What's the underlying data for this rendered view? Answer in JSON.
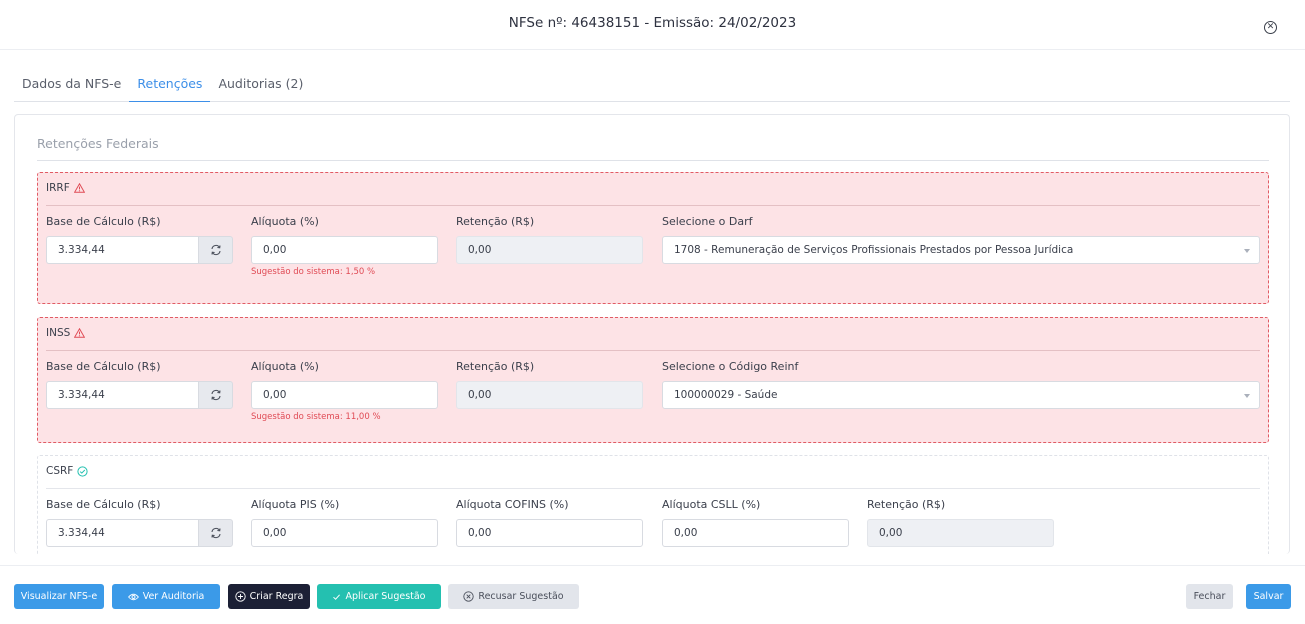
{
  "header": {
    "title": "NFSe nº: 46438151 - Emissão: 24/02/2023"
  },
  "tabs": [
    {
      "label": "Dados da NFS-e",
      "active": false
    },
    {
      "label": "Retenções",
      "active": true
    },
    {
      "label": "Auditorias (2)",
      "active": false
    }
  ],
  "section": {
    "title": "Retenções Federais"
  },
  "irrf": {
    "title": "IRRF",
    "status_icon": "warning-icon",
    "base_label": "Base de Cálculo (R$)",
    "base_value": "3.334,44",
    "aliquota_label": "Alíquota (%)",
    "aliquota_value": "0,00",
    "hint": "Sugestão do sistema: 1,50 %",
    "retencao_label": "Retenção (R$)",
    "retencao_value": "0,00",
    "select_label": "Selecione o Darf",
    "select_value": "1708 - Remuneração de Serviços Profissionais Prestados por Pessoa Jurídica"
  },
  "inss": {
    "title": "INSS",
    "status_icon": "warning-icon",
    "base_label": "Base de Cálculo (R$)",
    "base_value": "3.334,44",
    "aliquota_label": "Alíquota (%)",
    "aliquota_value": "0,00",
    "hint": "Sugestão do sistema: 11,00 %",
    "retencao_label": "Retenção (R$)",
    "retencao_value": "0,00",
    "select_label": "Selecione o Código Reinf",
    "select_value": "100000029 - Saúde"
  },
  "csrf": {
    "title": "CSRF",
    "status_icon": "check-circle-icon",
    "base_label": "Base de Cálculo (R$)",
    "base_value": "3.334,44",
    "pis_label": "Alíquota PIS (%)",
    "pis_value": "0,00",
    "cofins_label": "Alíquota COFINS (%)",
    "cofins_value": "0,00",
    "csll_label": "Alíquota CSLL (%)",
    "csll_value": "0,00",
    "retencao_label": "Retenção (R$)",
    "retencao_value": "0,00"
  },
  "footer": {
    "visualizar": "Visualizar NFS-e",
    "ver_auditoria": "Ver Auditoria",
    "criar_regra": "Criar Regra",
    "aplicar": "Aplicar Sugestão",
    "recusar": "Recusar Sugestão",
    "fechar": "Fechar",
    "salvar": "Salvar"
  },
  "colors": {
    "accent": "#3b9ae8",
    "danger_bg": "#fde3e6",
    "danger_border": "#e15b64",
    "teal": "#24c0b0",
    "dark": "#1c2035"
  }
}
